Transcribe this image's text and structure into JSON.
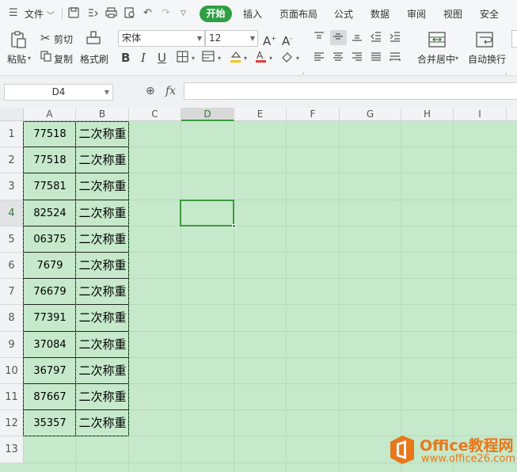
{
  "menubar": {
    "file_label": "文件",
    "tabs": [
      "开始",
      "插入",
      "页面布局",
      "公式",
      "数据",
      "审阅",
      "视图",
      "安全"
    ]
  },
  "ribbon": {
    "paste_label": "粘贴",
    "cut_label": "剪切",
    "copy_label": "复制",
    "format_painter_label": "格式刷",
    "font_name": "宋体",
    "font_size": "12",
    "merge_center_label": "合并居中",
    "wrap_text_label": "自动换行",
    "font_color": "#e53935",
    "fill_color": "#f5c518"
  },
  "formula_bar": {
    "name_box": "D4",
    "fx_label": "fx",
    "formula": ""
  },
  "sheet": {
    "columns": [
      "A",
      "B",
      "C",
      "D",
      "E",
      "F",
      "G",
      "H",
      "I"
    ],
    "active_column": "D",
    "active_row": 4,
    "rows": [
      {
        "num": "1",
        "a": "77518",
        "b": "二次称重"
      },
      {
        "num": "2",
        "a": "77518",
        "b": "二次称重"
      },
      {
        "num": "3",
        "a": "77581",
        "b": "二次称重"
      },
      {
        "num": "4",
        "a": "82524",
        "b": "二次称重"
      },
      {
        "num": "5",
        "a": "06375",
        "b": "二次称重"
      },
      {
        "num": "6",
        "a": "7679",
        "b": "二次称重"
      },
      {
        "num": "7",
        "a": "76679",
        "b": "二次称重"
      },
      {
        "num": "8",
        "a": "77391",
        "b": "二次称重"
      },
      {
        "num": "9",
        "a": "37084",
        "b": "二次称重"
      },
      {
        "num": "10",
        "a": "36797",
        "b": "二次称重"
      },
      {
        "num": "11",
        "a": "87667",
        "b": "二次称重"
      },
      {
        "num": "12",
        "a": "35357",
        "b": "二次称重"
      },
      {
        "num": "13",
        "a": "",
        "b": ""
      }
    ],
    "colors": {
      "sheet_background": "#c6e9cb",
      "accent": "#2ea043"
    }
  },
  "watermark": {
    "title": "Office教程网",
    "url": "www.office26.com"
  }
}
